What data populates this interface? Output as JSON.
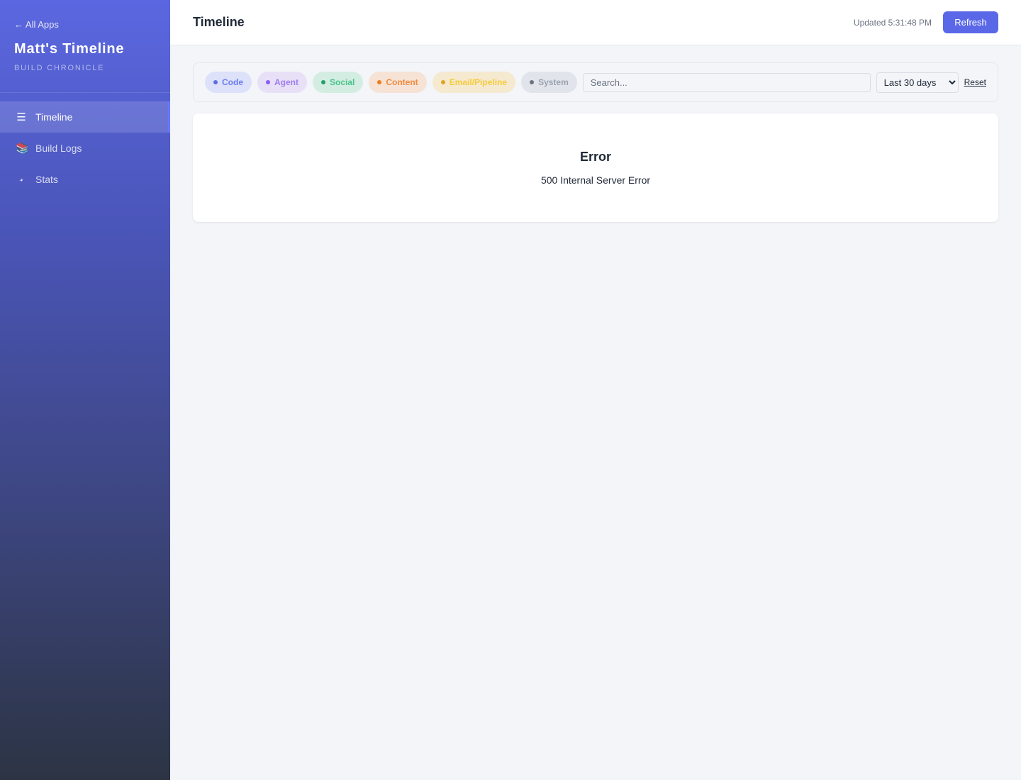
{
  "sidebar": {
    "back_link": "← All Apps",
    "title": "Matt's Timeline",
    "subtitle": "BUILD CHRONICLE",
    "items": [
      {
        "label": "Timeline",
        "icon": "list-icon",
        "glyph": "☰",
        "active": true
      },
      {
        "label": "Build Logs",
        "icon": "books-icon",
        "glyph": "📚",
        "active": false
      },
      {
        "label": "Stats",
        "icon": "pie-chart-icon",
        "glyph": "◕",
        "active": false
      }
    ]
  },
  "header": {
    "title": "Timeline",
    "updated": "Updated 5:31:48 PM",
    "refresh_label": "Refresh"
  },
  "filters": {
    "chips": [
      {
        "label": "Code",
        "bg": "#dde1fa",
        "text": "#6b7ef0",
        "dot": "#5b6ee0"
      },
      {
        "label": "Agent",
        "bg": "#e7e0f7",
        "text": "#a07cf0",
        "dot": "#8b5cf6"
      },
      {
        "label": "Social",
        "bg": "#d4ede2",
        "text": "#4cc28a",
        "dot": "#22a06b"
      },
      {
        "label": "Content",
        "bg": "#f6e3d6",
        "text": "#f08a3c",
        "dot": "#f07a1c"
      },
      {
        "label": "Email/Pipeline",
        "bg": "#f5e9d0",
        "text": "#f5cc3a",
        "dot": "#e0a520"
      },
      {
        "label": "System",
        "bg": "#e1e4ea",
        "text": "#9ca3af",
        "dot": "#6b7280"
      }
    ],
    "search_placeholder": "Search...",
    "range_selected": "Last 30 days",
    "reset_label": "Reset"
  },
  "error": {
    "title": "Error",
    "message": "500 Internal Server Error"
  },
  "colors": {
    "accent": "#5a68e8",
    "background": "#f3f5f9"
  }
}
